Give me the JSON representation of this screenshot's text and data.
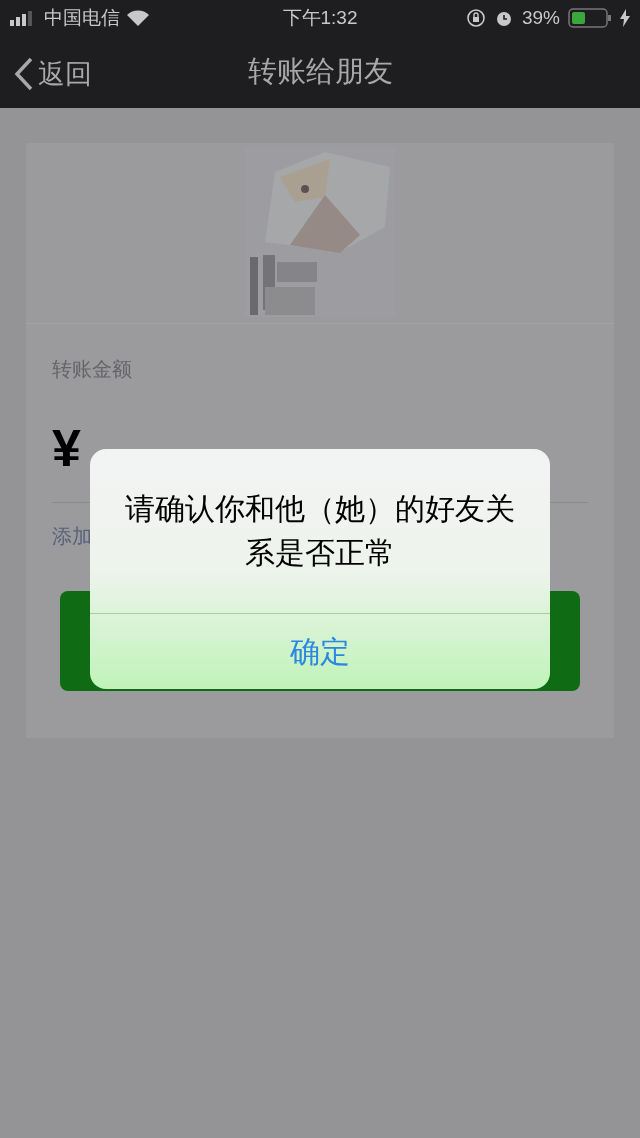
{
  "status_bar": {
    "carrier": "中国电信",
    "time": "下午1:32",
    "battery": "39%"
  },
  "nav_bar": {
    "back": "返回",
    "title": "转账给朋友"
  },
  "transfer": {
    "amount_label": "转账金额",
    "currency": "¥",
    "note_link": "添加"
  },
  "alert": {
    "message": "请确认你和他（她）的好友关系是否正常",
    "buttons": [
      "确定"
    ]
  }
}
